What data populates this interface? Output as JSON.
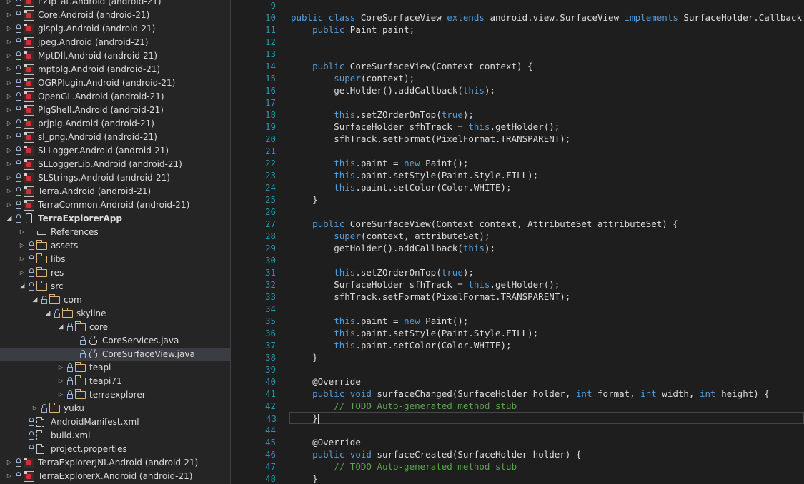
{
  "explorer": {
    "rows": [
      {
        "label": "I'Zip_at.Android (android-21)",
        "icon": "project-icon",
        "arrow": "collapsed",
        "level": 0
      },
      {
        "label": "Core.Android (android-21)",
        "icon": "project-icon",
        "arrow": "collapsed",
        "level": 0
      },
      {
        "label": "gisplg.Android (android-21)",
        "icon": "project-icon",
        "arrow": "collapsed",
        "level": 0
      },
      {
        "label": "jpeg.Android (android-21)",
        "icon": "project-icon",
        "arrow": "collapsed",
        "level": 0
      },
      {
        "label": "MptDll.Android (android-21)",
        "icon": "project-icon",
        "arrow": "collapsed",
        "level": 0
      },
      {
        "label": "mptplg.Android (android-21)",
        "icon": "project-icon",
        "arrow": "collapsed",
        "level": 0
      },
      {
        "label": "OGRPlugin.Android (android-21)",
        "icon": "project-icon",
        "arrow": "collapsed",
        "level": 0
      },
      {
        "label": "OpenGL.Android (android-21)",
        "icon": "project-icon",
        "arrow": "collapsed",
        "level": 0
      },
      {
        "label": "PlgShell.Android (android-21)",
        "icon": "project-icon",
        "arrow": "collapsed",
        "level": 0
      },
      {
        "label": "prjplg.Android (android-21)",
        "icon": "project-icon",
        "arrow": "collapsed",
        "level": 0
      },
      {
        "label": "sl_png.Android (android-21)",
        "icon": "project-icon",
        "arrow": "collapsed",
        "level": 0
      },
      {
        "label": "SLLogger.Android (android-21)",
        "icon": "project-icon",
        "arrow": "collapsed",
        "level": 0
      },
      {
        "label": "SLLoggerLib.Android (android-21)",
        "icon": "project-icon",
        "arrow": "collapsed",
        "level": 0
      },
      {
        "label": "SLStrings.Android (android-21)",
        "icon": "project-icon",
        "arrow": "collapsed",
        "level": 0
      },
      {
        "label": "Terra.Android (android-21)",
        "icon": "project-icon",
        "arrow": "collapsed",
        "level": 0
      },
      {
        "label": "TerraCommon.Android (android-21)",
        "icon": "project-icon",
        "arrow": "collapsed",
        "level": 0
      },
      {
        "label": "TerraExplorerApp",
        "icon": "android-project-icon",
        "arrow": "expanded",
        "level": 0,
        "bold": true
      },
      {
        "label": "References",
        "icon": "references-icon",
        "arrow": "collapsed",
        "level": 1,
        "nolock": true
      },
      {
        "label": "assets",
        "icon": "folder-icon",
        "arrow": "collapsed",
        "level": 1
      },
      {
        "label": "libs",
        "icon": "folder-icon",
        "arrow": "collapsed",
        "level": 1
      },
      {
        "label": "res",
        "icon": "folder-icon",
        "arrow": "collapsed",
        "level": 1
      },
      {
        "label": "src",
        "icon": "folder-open-icon",
        "arrow": "expanded",
        "level": 1
      },
      {
        "label": "com",
        "icon": "folder-open-icon",
        "arrow": "expanded",
        "level": 2
      },
      {
        "label": "skyline",
        "icon": "folder-open-icon",
        "arrow": "expanded",
        "level": 3
      },
      {
        "label": "core",
        "icon": "folder-open-icon",
        "arrow": "expanded",
        "level": 4
      },
      {
        "label": "CoreServices.java",
        "icon": "java-file-icon",
        "arrow": "none",
        "level": 5
      },
      {
        "label": "CoreSurfaceView.java",
        "icon": "java-file-icon",
        "arrow": "none",
        "level": 5,
        "selected": true
      },
      {
        "label": "teapi",
        "icon": "folder-icon",
        "arrow": "collapsed",
        "level": 4
      },
      {
        "label": "teapi71",
        "icon": "folder-icon",
        "arrow": "collapsed",
        "level": 4
      },
      {
        "label": "terraexplorer",
        "icon": "folder-icon",
        "arrow": "collapsed",
        "level": 4
      },
      {
        "label": "yuku",
        "icon": "folder-icon",
        "arrow": "collapsed",
        "level": 2
      },
      {
        "label": "AndroidManifest.xml",
        "icon": "xml-file-icon",
        "arrow": "none",
        "level": 1
      },
      {
        "label": "build.xml",
        "icon": "xml-file-icon",
        "arrow": "none",
        "level": 1
      },
      {
        "label": "project.properties",
        "icon": "file-icon",
        "arrow": "none",
        "level": 1
      },
      {
        "label": "TerraExplorerJNI.Android (android-21)",
        "icon": "project-icon",
        "arrow": "collapsed",
        "level": 0
      },
      {
        "label": "TerraExplorerX.Android (android-21)",
        "icon": "project-icon",
        "arrow": "collapsed",
        "level": 0
      }
    ]
  },
  "editor": {
    "current_line": "43",
    "lines": [
      {
        "n": "9",
        "segments": []
      },
      {
        "n": "10",
        "segments": [
          [
            "kw",
            "public"
          ],
          [
            "t",
            " "
          ],
          [
            "kw",
            "class"
          ],
          [
            "t",
            " CoreSurfaceView "
          ],
          [
            "kw",
            "extends"
          ],
          [
            "t",
            " android.view.SurfaceView "
          ],
          [
            "kw",
            "implements"
          ],
          [
            "t",
            " SurfaceHolder.Callback"
          ]
        ]
      },
      {
        "n": "11",
        "segments": [
          [
            "t",
            "    "
          ],
          [
            "kw",
            "public"
          ],
          [
            "t",
            " Paint paint;"
          ]
        ]
      },
      {
        "n": "12",
        "segments": []
      },
      {
        "n": "13",
        "segments": []
      },
      {
        "n": "14",
        "segments": [
          [
            "t",
            "    "
          ],
          [
            "kw",
            "public"
          ],
          [
            "t",
            " CoreSurfaceView(Context context) {"
          ]
        ]
      },
      {
        "n": "15",
        "segments": [
          [
            "t",
            "        "
          ],
          [
            "kw",
            "super"
          ],
          [
            "t",
            "(context);"
          ]
        ]
      },
      {
        "n": "16",
        "segments": [
          [
            "t",
            "        getHolder().addCallback("
          ],
          [
            "kw",
            "this"
          ],
          [
            "t",
            ");"
          ]
        ]
      },
      {
        "n": "17",
        "segments": []
      },
      {
        "n": "18",
        "segments": [
          [
            "t",
            "        "
          ],
          [
            "kw",
            "this"
          ],
          [
            "t",
            ".setZOrderOnTop("
          ],
          [
            "kw",
            "true"
          ],
          [
            "t",
            ");"
          ]
        ]
      },
      {
        "n": "19",
        "segments": [
          [
            "t",
            "        SurfaceHolder sfhTrack = "
          ],
          [
            "kw",
            "this"
          ],
          [
            "t",
            ".getHolder();"
          ]
        ]
      },
      {
        "n": "20",
        "segments": [
          [
            "t",
            "        sfhTrack.setFormat(PixelFormat.TRANSPARENT);"
          ]
        ]
      },
      {
        "n": "21",
        "segments": []
      },
      {
        "n": "22",
        "segments": [
          [
            "t",
            "        "
          ],
          [
            "kw",
            "this"
          ],
          [
            "t",
            ".paint = "
          ],
          [
            "kw",
            "new"
          ],
          [
            "t",
            " Paint();"
          ]
        ]
      },
      {
        "n": "23",
        "segments": [
          [
            "t",
            "        "
          ],
          [
            "kw",
            "this"
          ],
          [
            "t",
            ".paint.setStyle(Paint.Style.FILL);"
          ]
        ]
      },
      {
        "n": "24",
        "segments": [
          [
            "t",
            "        "
          ],
          [
            "kw",
            "this"
          ],
          [
            "t",
            ".paint.setColor(Color.WHITE);"
          ]
        ]
      },
      {
        "n": "25",
        "segments": [
          [
            "t",
            "    }"
          ]
        ]
      },
      {
        "n": "26",
        "segments": []
      },
      {
        "n": "27",
        "segments": [
          [
            "t",
            "    "
          ],
          [
            "kw",
            "public"
          ],
          [
            "t",
            " CoreSurfaceView(Context context, AttributeSet attributeSet) {"
          ]
        ]
      },
      {
        "n": "28",
        "segments": [
          [
            "t",
            "        "
          ],
          [
            "kw",
            "super"
          ],
          [
            "t",
            "(context, attributeSet);"
          ]
        ]
      },
      {
        "n": "29",
        "segments": [
          [
            "t",
            "        getHolder().addCallback("
          ],
          [
            "kw",
            "this"
          ],
          [
            "t",
            ");"
          ]
        ]
      },
      {
        "n": "30",
        "segments": []
      },
      {
        "n": "31",
        "segments": [
          [
            "t",
            "        "
          ],
          [
            "kw",
            "this"
          ],
          [
            "t",
            ".setZOrderOnTop("
          ],
          [
            "kw",
            "true"
          ],
          [
            "t",
            ");"
          ]
        ]
      },
      {
        "n": "32",
        "segments": [
          [
            "t",
            "        SurfaceHolder sfhTrack = "
          ],
          [
            "kw",
            "this"
          ],
          [
            "t",
            ".getHolder();"
          ]
        ]
      },
      {
        "n": "33",
        "segments": [
          [
            "t",
            "        sfhTrack.setFormat(PixelFormat.TRANSPARENT);"
          ]
        ]
      },
      {
        "n": "34",
        "segments": []
      },
      {
        "n": "35",
        "segments": [
          [
            "t",
            "        "
          ],
          [
            "kw",
            "this"
          ],
          [
            "t",
            ".paint = "
          ],
          [
            "kw",
            "new"
          ],
          [
            "t",
            " Paint();"
          ]
        ]
      },
      {
        "n": "36",
        "segments": [
          [
            "t",
            "        "
          ],
          [
            "kw",
            "this"
          ],
          [
            "t",
            ".paint.setStyle(Paint.Style.FILL);"
          ]
        ]
      },
      {
        "n": "37",
        "segments": [
          [
            "t",
            "        "
          ],
          [
            "kw",
            "this"
          ],
          [
            "t",
            ".paint.setColor(Color.WHITE);"
          ]
        ]
      },
      {
        "n": "38",
        "segments": [
          [
            "t",
            "    }"
          ]
        ]
      },
      {
        "n": "39",
        "segments": []
      },
      {
        "n": "40",
        "segments": [
          [
            "t",
            "    "
          ],
          [
            "ann",
            "@Override"
          ]
        ]
      },
      {
        "n": "41",
        "segments": [
          [
            "t",
            "    "
          ],
          [
            "kw",
            "public"
          ],
          [
            "t",
            " "
          ],
          [
            "kw",
            "void"
          ],
          [
            "t",
            " surfaceChanged(SurfaceHolder holder, "
          ],
          [
            "kw",
            "int"
          ],
          [
            "t",
            " format, "
          ],
          [
            "kw",
            "int"
          ],
          [
            "t",
            " width, "
          ],
          [
            "kw",
            "int"
          ],
          [
            "t",
            " height) {"
          ]
        ]
      },
      {
        "n": "42",
        "segments": [
          [
            "t",
            "        "
          ],
          [
            "cm",
            "// TODO Auto-generated method stub"
          ]
        ]
      },
      {
        "n": "43",
        "segments": [
          [
            "t",
            "    }"
          ]
        ]
      },
      {
        "n": "44",
        "segments": []
      },
      {
        "n": "45",
        "segments": [
          [
            "t",
            "    "
          ],
          [
            "ann",
            "@Override"
          ]
        ]
      },
      {
        "n": "46",
        "segments": [
          [
            "t",
            "    "
          ],
          [
            "kw",
            "public"
          ],
          [
            "t",
            " "
          ],
          [
            "kw",
            "void"
          ],
          [
            "t",
            " surfaceCreated(SurfaceHolder holder) {"
          ]
        ]
      },
      {
        "n": "47",
        "segments": [
          [
            "t",
            "        "
          ],
          [
            "cm",
            "// TODO Auto-generated method stub"
          ]
        ]
      },
      {
        "n": "48",
        "segments": [
          [
            "t",
            "    }"
          ]
        ]
      }
    ]
  },
  "colors": {
    "keyword": "#569cd6",
    "text": "#dcdcdc",
    "comment": "#57a64a",
    "annotation": "#dcdcdc",
    "line_number": "#2b91af",
    "selection": "#3a3d41",
    "project_red": "#c83232",
    "folder": "#dcb67a"
  }
}
